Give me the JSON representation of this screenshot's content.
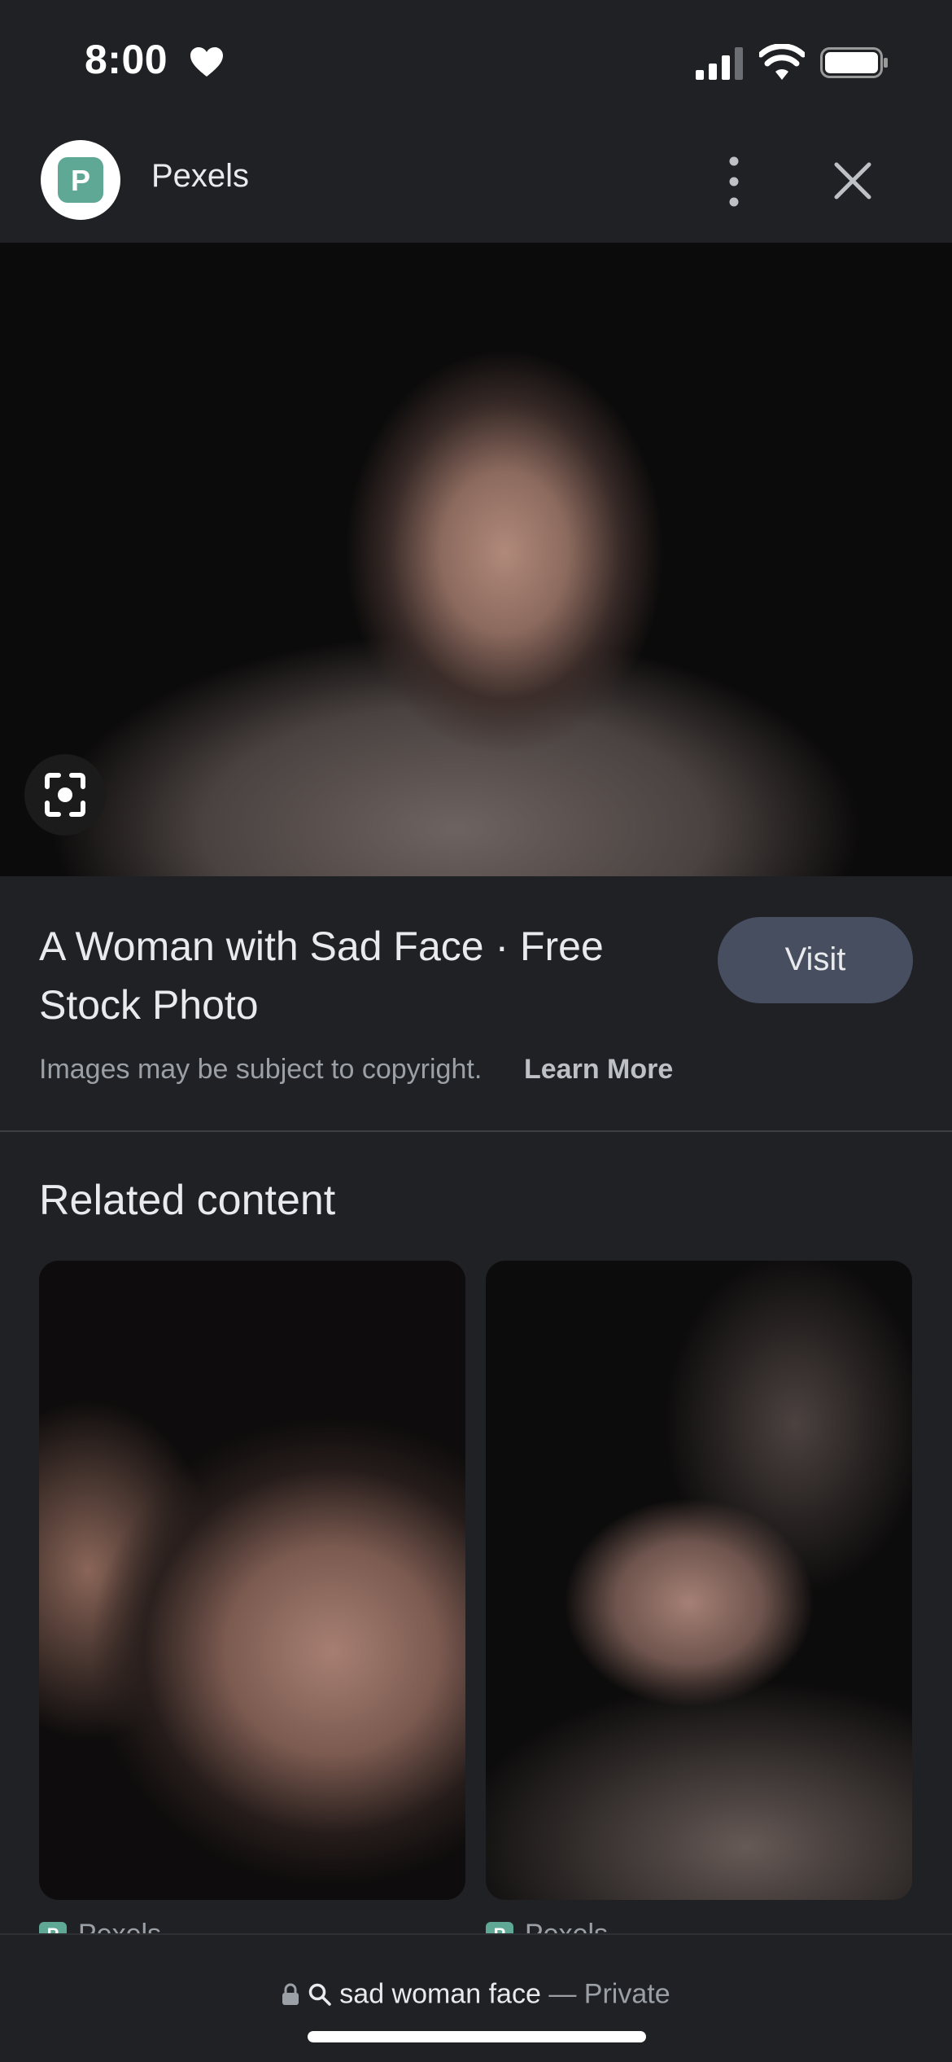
{
  "status_bar": {
    "time": "8:00",
    "icons": [
      "heart-icon",
      "signal-icon",
      "wifi-icon",
      "battery-icon"
    ]
  },
  "header": {
    "site_name": "Pexels",
    "logo_letter": "P",
    "more_icon": "more-vert-icon",
    "close_icon": "close-icon"
  },
  "hero": {
    "lens_icon": "google-lens-icon"
  },
  "result": {
    "title": "A Woman with Sad Face · Free Stock Photo",
    "visit_label": "Visit",
    "copyright_text": "Images may be subject to copyright.",
    "learn_more_label": "Learn More"
  },
  "related": {
    "title": "Related content",
    "items": [
      {
        "source": "Pexels",
        "favicon_letter": "P"
      },
      {
        "source": "Pexels",
        "favicon_letter": "P"
      }
    ]
  },
  "bottom_bar": {
    "query": "sad woman face",
    "mode": "— Private"
  },
  "colors": {
    "background": "#202124",
    "visit_button": "#474e60",
    "favicon": "#5ea895"
  }
}
